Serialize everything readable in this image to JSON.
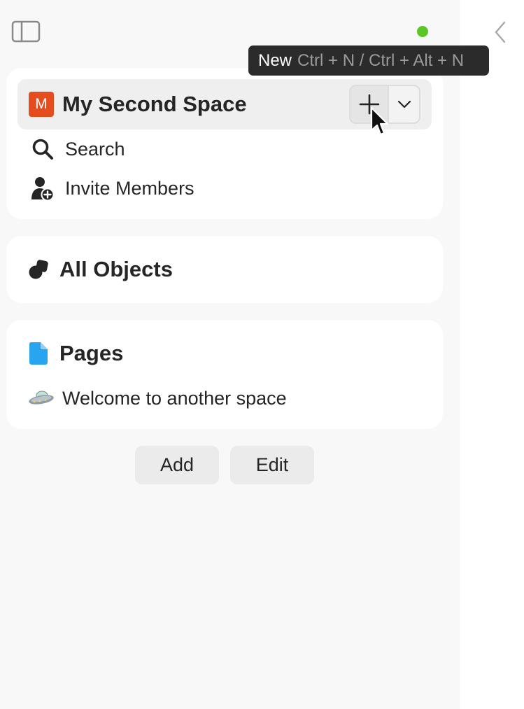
{
  "colors": {
    "status_dot": "#5ac724",
    "space_avatar": "#e54d1e",
    "pages_icon": "#29a5ef"
  },
  "tooltip": {
    "label": "New",
    "shortcut": "Ctrl + N / Ctrl + Alt + N"
  },
  "space": {
    "avatar_letter": "M",
    "name": "My Second Space",
    "new_button_icon": "plus-icon",
    "dropdown_icon": "chevron-down-icon"
  },
  "menu": {
    "search": {
      "label": "Search",
      "icon": "search-icon"
    },
    "invite": {
      "label": "Invite Members",
      "icon": "invite-member-icon"
    }
  },
  "objects": {
    "label": "All Objects",
    "icon": "objects-icon"
  },
  "pages": {
    "label": "Pages",
    "icon": "page-icon",
    "items": [
      {
        "emoji": "🛸",
        "label": "Welcome to another space"
      }
    ]
  },
  "footer": {
    "add_label": "Add",
    "edit_label": "Edit"
  }
}
